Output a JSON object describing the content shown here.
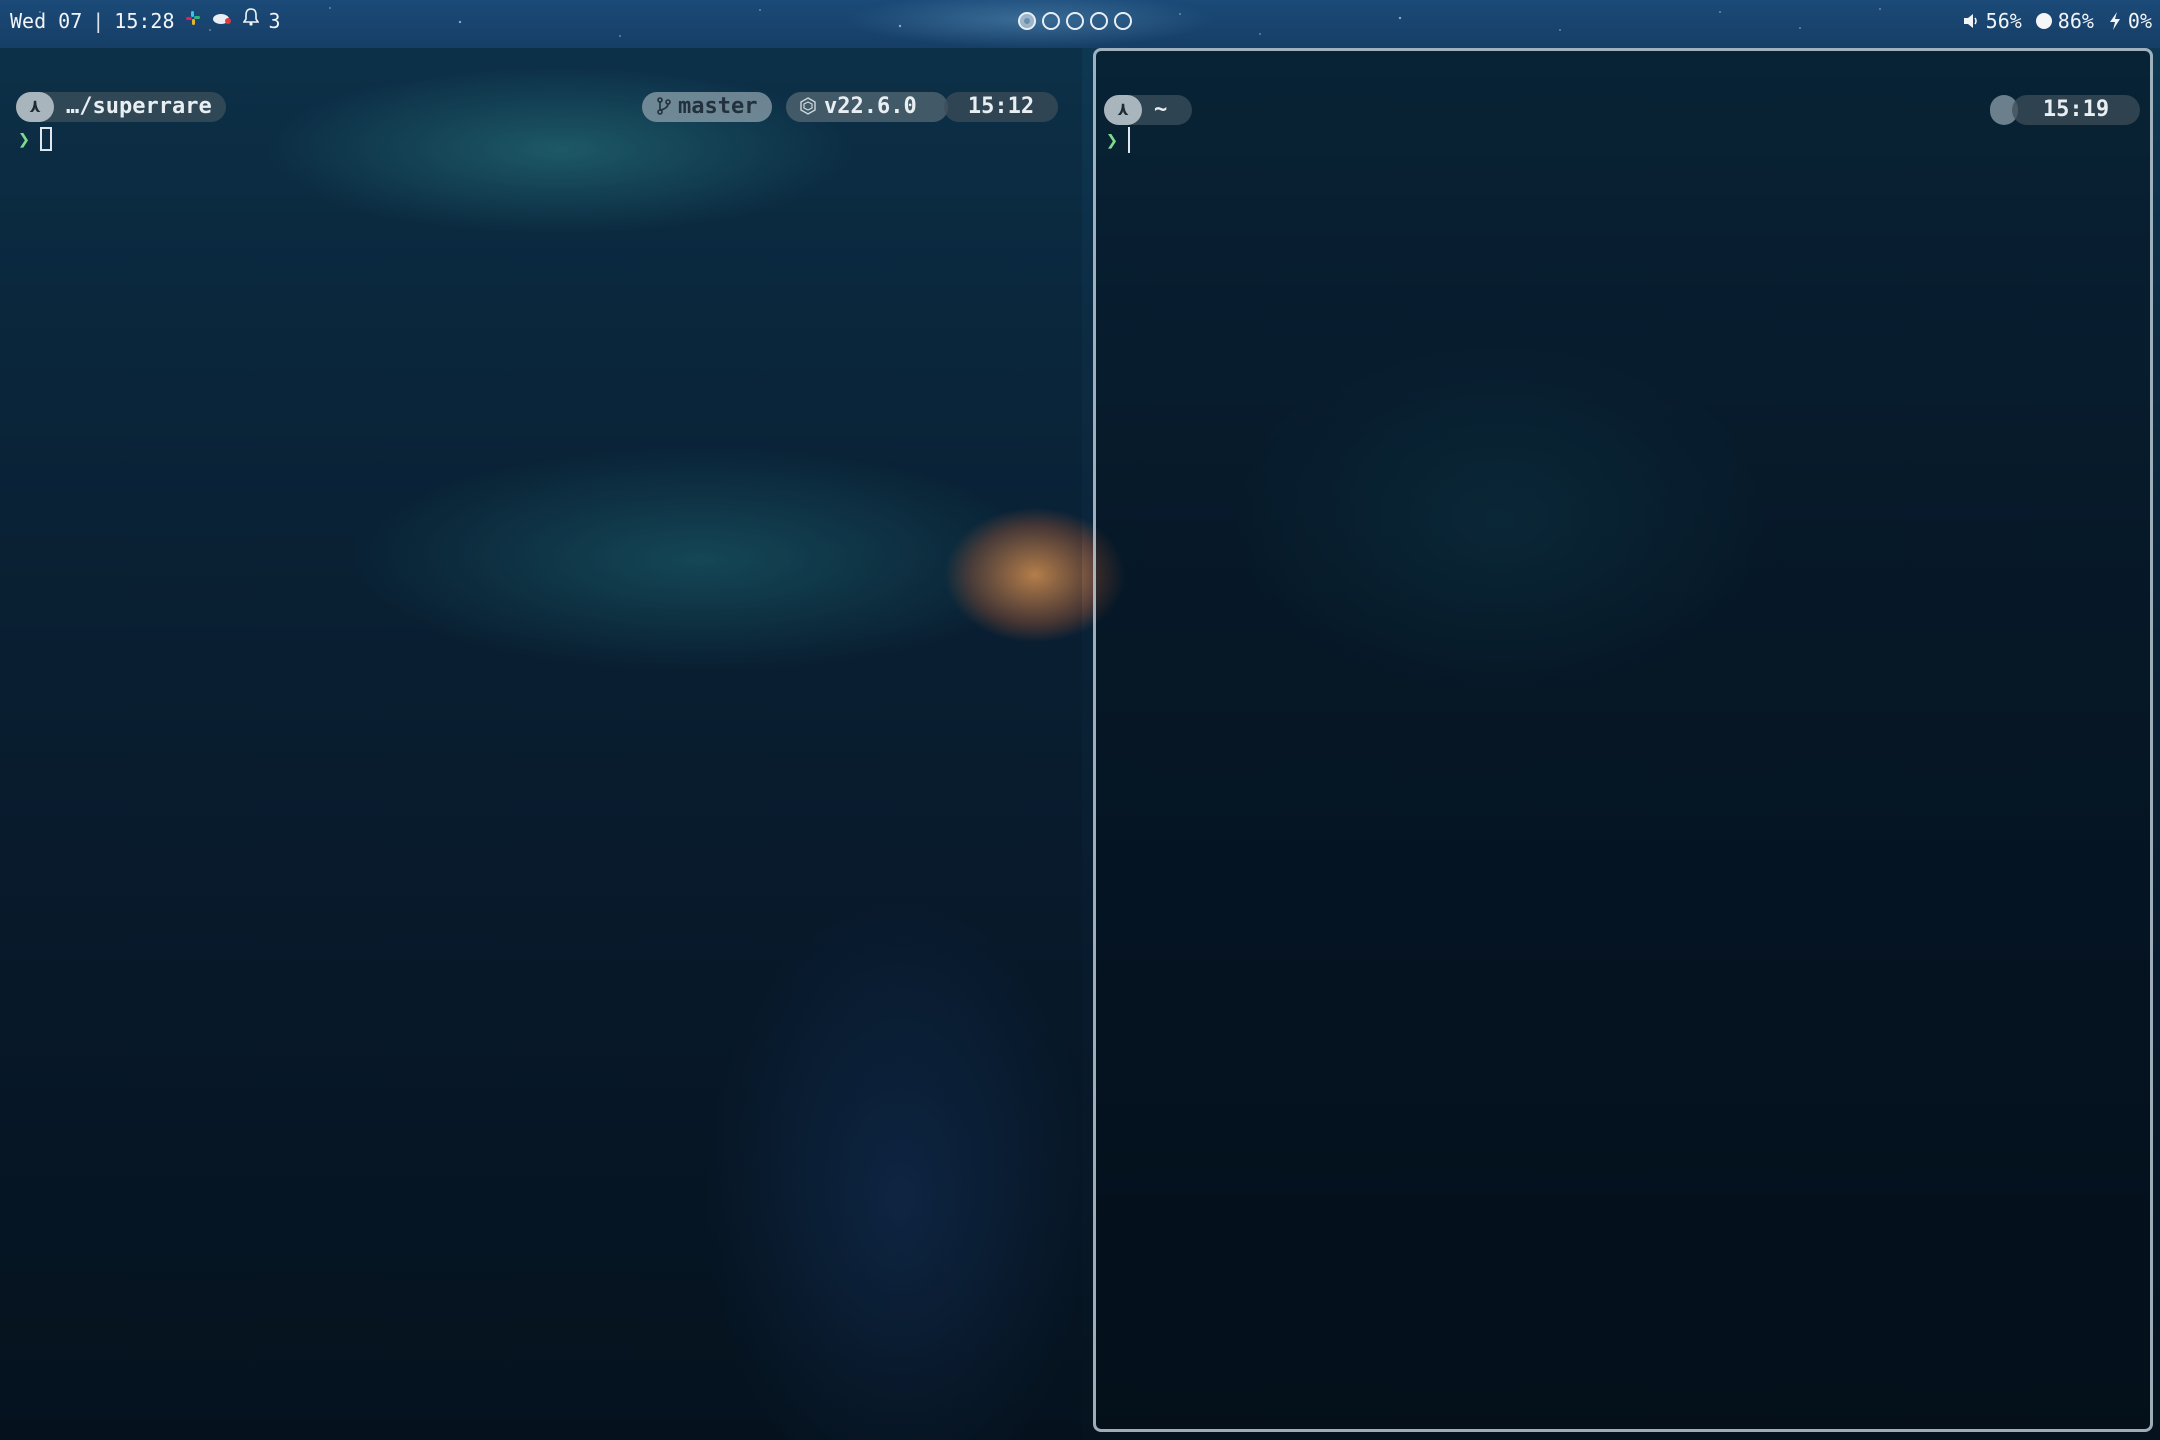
{
  "topbar": {
    "date": "Wed 07",
    "separator": "|",
    "time": "15:28",
    "notifications_count": "3",
    "workspaces": [
      {
        "active": true
      },
      {
        "active": false
      },
      {
        "active": false
      },
      {
        "active": false
      },
      {
        "active": false
      }
    ],
    "volume": "56%",
    "brightness": "86%",
    "battery": "0%"
  },
  "panes": [
    {
      "focused": false,
      "os_badge": "⋏",
      "directory": "…/superrare",
      "git_branch": "master",
      "node_version": "v22.6.0",
      "time": "15:12",
      "prompt_char": "❯"
    },
    {
      "focused": true,
      "os_badge": "⋏",
      "directory": "~",
      "time": "15:19",
      "prompt_char": "❯"
    }
  ],
  "icons": {
    "slack": "slack-icon",
    "cloud": "cloud-icon",
    "bell": "bell-icon",
    "volume": "volume-icon",
    "brightness": "brightness-icon",
    "battery": "bolt-icon",
    "git": "git-branch-icon",
    "node": "node-icon"
  },
  "colors": {
    "prompt_green": "#7ddc8a",
    "focus_border": "#d2e1eb"
  }
}
